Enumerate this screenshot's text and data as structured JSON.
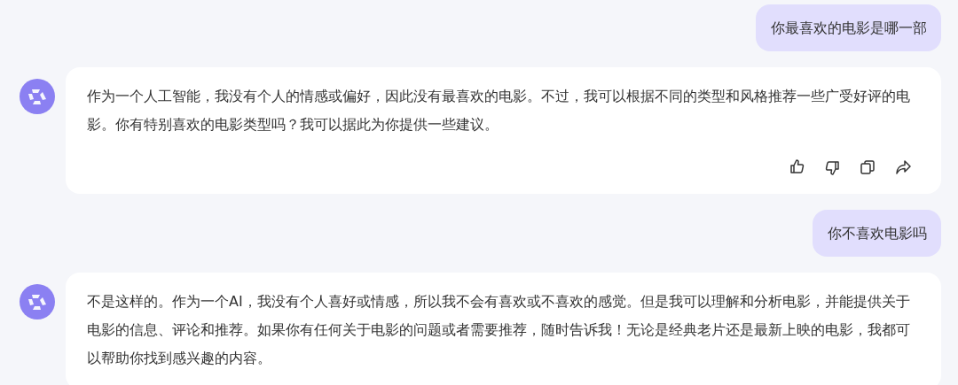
{
  "messages": [
    {
      "kind": "user",
      "text": "你最喜欢的电影是哪一部"
    },
    {
      "kind": "assistant",
      "text": "作为一个人工智能，我没有个人的情感或偏好，因此没有最喜欢的电影。不过，我可以根据不同的类型和风格推荐一些广受好评的电影。你有特别喜欢的电影类型吗？我可以据此为你提供一些建议。",
      "actions": true
    },
    {
      "kind": "user",
      "text": "你不喜欢电影吗"
    },
    {
      "kind": "assistant",
      "text": "不是这样的。作为一个AI，我没有个人喜好或情感，所以我不会有喜欢或不喜欢的感觉。但是我可以理解和分析电影，并能提供关于电影的信息、评论和推荐。如果你有任何关于电影的问题或者需要推荐，随时告诉我！无论是经典老片还是最新上映的电影，我都可以帮助你找到感兴趣的内容。",
      "actions": false
    }
  ]
}
